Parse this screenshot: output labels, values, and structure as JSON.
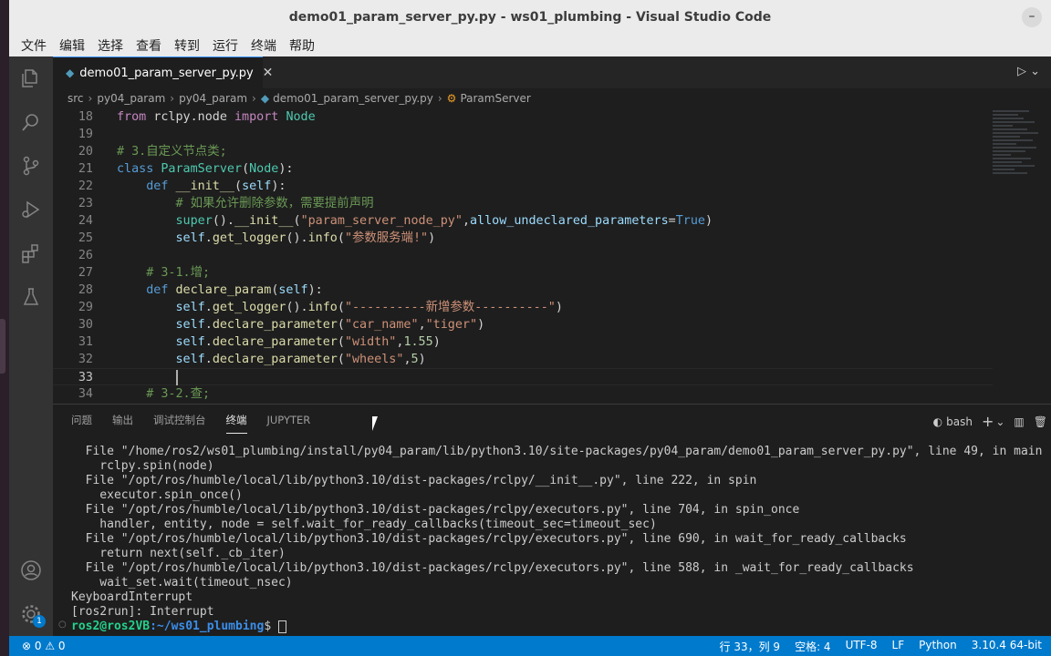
{
  "window": {
    "title": "demo01_param_server_py.py - ws01_plumbing - Visual Studio Code",
    "minimize": "–"
  },
  "menu": [
    "文件",
    "编辑",
    "选择",
    "查看",
    "转到",
    "运行",
    "终端",
    "帮助"
  ],
  "tab": {
    "icon": "python-file-icon",
    "label": "demo01_param_server_py.py",
    "close": "✕"
  },
  "breadcrumb": {
    "items": [
      "src",
      "py04_param",
      "py04_param",
      "demo01_param_server_py.py",
      "ParamServer"
    ]
  },
  "code": {
    "lines": [
      {
        "n": "18",
        "tokens": [
          [
            "kw2",
            "from "
          ],
          [
            "",
            "rclpy.node "
          ],
          [
            "kw2",
            "import "
          ],
          [
            "cls",
            "Node"
          ]
        ]
      },
      {
        "n": "19",
        "tokens": []
      },
      {
        "n": "20",
        "tokens": [
          [
            "cmt",
            "# 3.自定义节点类;"
          ]
        ]
      },
      {
        "n": "21",
        "tokens": [
          [
            "kw",
            "class "
          ],
          [
            "cls",
            "ParamServer"
          ],
          [
            "",
            "("
          ],
          [
            "cls",
            "Node"
          ],
          [
            "",
            "):"
          ]
        ]
      },
      {
        "n": "22",
        "tokens": [
          [
            "",
            "    "
          ],
          [
            "kw",
            "def "
          ],
          [
            "fn",
            "__init__"
          ],
          [
            "",
            "("
          ],
          [
            "var",
            "self"
          ],
          [
            "",
            "):"
          ]
        ]
      },
      {
        "n": "23",
        "tokens": [
          [
            "",
            "        "
          ],
          [
            "cmt",
            "# 如果允许删除参数，需要提前声明"
          ]
        ]
      },
      {
        "n": "24",
        "tokens": [
          [
            "",
            "        "
          ],
          [
            "cls",
            "super"
          ],
          [
            "",
            "()."
          ],
          [
            "fn",
            "__init__"
          ],
          [
            "",
            "("
          ],
          [
            "str",
            "\"param_server_node_py\""
          ],
          [
            "",
            ","
          ],
          [
            "var",
            "allow_undeclared_parameters"
          ],
          [
            "",
            "="
          ],
          [
            "kw",
            "True"
          ],
          [
            "",
            ")"
          ]
        ]
      },
      {
        "n": "25",
        "tokens": [
          [
            "",
            "        "
          ],
          [
            "var",
            "self"
          ],
          [
            "",
            "."
          ],
          [
            "fn",
            "get_logger"
          ],
          [
            "",
            "()."
          ],
          [
            "fn",
            "info"
          ],
          [
            "",
            "("
          ],
          [
            "str",
            "\"参数服务端!\""
          ],
          [
            "",
            ")"
          ]
        ]
      },
      {
        "n": "26",
        "tokens": []
      },
      {
        "n": "27",
        "tokens": [
          [
            "",
            "    "
          ],
          [
            "cmt",
            "# 3-1.增;"
          ]
        ]
      },
      {
        "n": "28",
        "tokens": [
          [
            "",
            "    "
          ],
          [
            "kw",
            "def "
          ],
          [
            "fn",
            "declare_param"
          ],
          [
            "",
            "("
          ],
          [
            "var",
            "self"
          ],
          [
            "",
            "):"
          ]
        ]
      },
      {
        "n": "29",
        "tokens": [
          [
            "",
            "        "
          ],
          [
            "var",
            "self"
          ],
          [
            "",
            "."
          ],
          [
            "fn",
            "get_logger"
          ],
          [
            "",
            "()."
          ],
          [
            "fn",
            "info"
          ],
          [
            "",
            "("
          ],
          [
            "str",
            "\"----------新增参数----------\""
          ],
          [
            "",
            ")"
          ]
        ]
      },
      {
        "n": "30",
        "tokens": [
          [
            "",
            "        "
          ],
          [
            "var",
            "self"
          ],
          [
            "",
            "."
          ],
          [
            "fn",
            "declare_parameter"
          ],
          [
            "",
            "("
          ],
          [
            "str",
            "\"car_name\""
          ],
          [
            "",
            ","
          ],
          [
            "str",
            "\"tiger\""
          ],
          [
            "",
            ")"
          ]
        ]
      },
      {
        "n": "31",
        "tokens": [
          [
            "",
            "        "
          ],
          [
            "var",
            "self"
          ],
          [
            "",
            "."
          ],
          [
            "fn",
            "declare_parameter"
          ],
          [
            "",
            "("
          ],
          [
            "str",
            "\"width\""
          ],
          [
            "",
            ","
          ],
          [
            "num",
            "1.55"
          ],
          [
            "",
            ")"
          ]
        ]
      },
      {
        "n": "32",
        "tokens": [
          [
            "",
            "        "
          ],
          [
            "var",
            "self"
          ],
          [
            "",
            "."
          ],
          [
            "fn",
            "declare_parameter"
          ],
          [
            "",
            "("
          ],
          [
            "str",
            "\"wheels\""
          ],
          [
            "",
            ","
          ],
          [
            "num",
            "5"
          ],
          [
            "",
            ")"
          ]
        ]
      },
      {
        "n": "33",
        "tokens": [
          [
            "",
            "        "
          ]
        ],
        "current": true
      },
      {
        "n": "34",
        "tokens": [
          [
            "",
            "    "
          ],
          [
            "cmt",
            "# 3-2.查;"
          ]
        ]
      }
    ]
  },
  "panel": {
    "tabs": [
      "问题",
      "输出",
      "调试控制台",
      "终端",
      "JUPYTER"
    ],
    "active_tab": "终端",
    "shell": "bash",
    "add": "+",
    "chevron": "⌄"
  },
  "terminal": {
    "lines": [
      "  File \"/home/ros2/ws01_plumbing/install/py04_param/lib/python3.10/site-packages/py04_param/demo01_param_server_py.py\", line 49, in main",
      "    rclpy.spin(node)",
      "  File \"/opt/ros/humble/local/lib/python3.10/dist-packages/rclpy/__init__.py\", line 222, in spin",
      "    executor.spin_once()",
      "  File \"/opt/ros/humble/local/lib/python3.10/dist-packages/rclpy/executors.py\", line 704, in spin_once",
      "    handler, entity, node = self.wait_for_ready_callbacks(timeout_sec=timeout_sec)",
      "  File \"/opt/ros/humble/local/lib/python3.10/dist-packages/rclpy/executors.py\", line 690, in wait_for_ready_callbacks",
      "    return next(self._cb_iter)",
      "  File \"/opt/ros/humble/local/lib/python3.10/dist-packages/rclpy/executors.py\", line 588, in _wait_for_ready_callbacks",
      "    wait_set.wait(timeout_nsec)",
      "KeyboardInterrupt",
      "[ros2run]: Interrupt"
    ],
    "prompt_user": "ros2@ros2VB",
    "prompt_path": ":~/ws01_plumbing",
    "prompt_symbol": "$ "
  },
  "status": {
    "problems": "⊗ 0 ⚠ 0",
    "position": "行 33，列 9",
    "spaces": "空格: 4",
    "encoding": "UTF-8",
    "eol": "LF",
    "language": "Python",
    "interpreter": "3.10.4 64-bit"
  },
  "accounts_badge": "1"
}
